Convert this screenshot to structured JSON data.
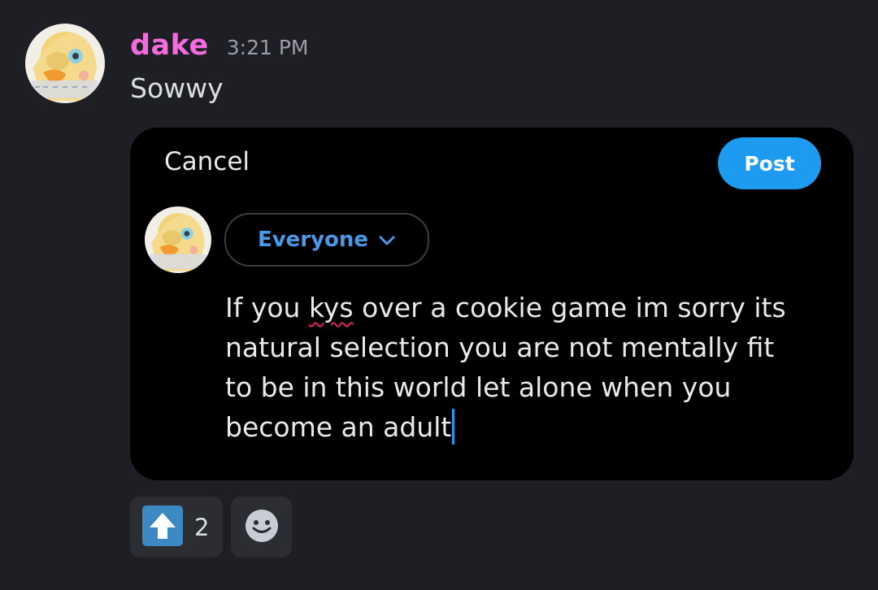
{
  "message": {
    "username": "dake",
    "timestamp": "3:21 PM",
    "text": "Sowwy",
    "accent_color": "#f36bdc"
  },
  "embed": {
    "cancel_label": "Cancel",
    "post_label": "Post",
    "audience_label": "Everyone",
    "audience_icon": "chevron-down-icon",
    "compose_lines": [
      [
        "If you ",
        "kys",
        " over a cookie game im sorry its"
      ],
      "natural selection you are not mentally fit",
      "to be in this world let alone when you",
      "become an adult"
    ],
    "accent_color": "#1d9bf0"
  },
  "reactions": [
    {
      "icon": "arrow-up-icon",
      "count": "2"
    },
    {
      "icon": "add-reaction-icon"
    }
  ]
}
